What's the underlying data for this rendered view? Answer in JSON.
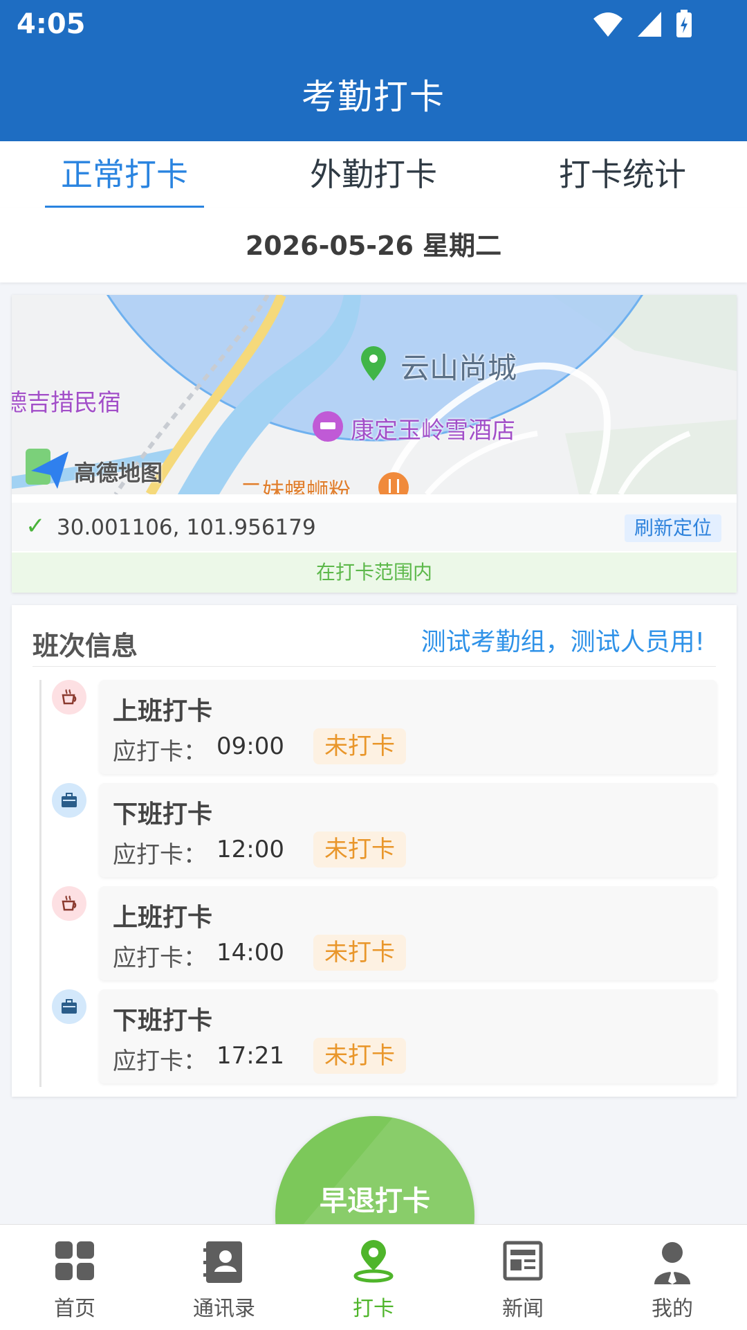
{
  "status": {
    "time": "4:05"
  },
  "header": {
    "title": "考勤打卡"
  },
  "tabs": [
    {
      "label": "正常打卡",
      "active": true
    },
    {
      "label": "外勤打卡",
      "active": false
    },
    {
      "label": "打卡统计",
      "active": false
    }
  ],
  "date": "2026-05-26 星期二",
  "map": {
    "labels": {
      "place1": "云山尚城",
      "place2": "德吉措民宿",
      "hotel": "康定玉岭雪酒店",
      "restaurant": "二妹螺蛳粉",
      "logo": "高德地图"
    },
    "coords": "30.001106, 101.956179",
    "refresh_label": "刷新定位",
    "range_status": "在打卡范围内"
  },
  "shift": {
    "title": "班次信息",
    "group": "测试考勤组，测试人员用!",
    "label_prefix": "应打卡：",
    "entries": [
      {
        "type": "上班打卡",
        "time": "09:00",
        "status": "未打卡"
      },
      {
        "type": "下班打卡",
        "time": "12:00",
        "status": "未打卡"
      },
      {
        "type": "上班打卡",
        "time": "14:00",
        "status": "未打卡"
      },
      {
        "type": "下班打卡",
        "time": "17:21",
        "status": "未打卡"
      }
    ]
  },
  "punch_button": {
    "label": "早退打卡"
  },
  "nav": [
    {
      "label": "首页"
    },
    {
      "label": "通讯录"
    },
    {
      "label": "打卡"
    },
    {
      "label": "新闻"
    },
    {
      "label": "我的"
    }
  ],
  "colors": {
    "primary": "#1e6dc2",
    "accent": "#2a84e0",
    "success": "#4fb52b",
    "warning": "#e9962a"
  }
}
